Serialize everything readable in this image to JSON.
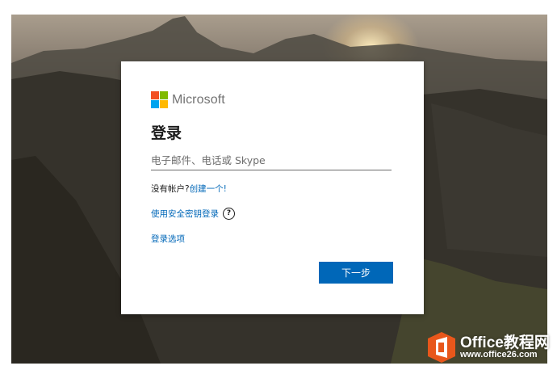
{
  "brand": {
    "name": "Microsoft",
    "logo_colors": [
      "#f25022",
      "#7fba00",
      "#00a4ef",
      "#ffb900"
    ]
  },
  "signin": {
    "title": "登录",
    "email_placeholder": "电子邮件、电话或 Skype",
    "email_value": "",
    "no_account_text": "没有帐户?",
    "create_link": "创建一个!",
    "security_key_link": "使用安全密钥登录",
    "help_icon": "?",
    "options_link": "登录选项",
    "next_button": "下一步"
  },
  "colors": {
    "accent": "#0067b8",
    "watermark_orange": "#e8571b"
  },
  "watermark": {
    "title": "Office教程网",
    "url": "www.office26.com",
    "icon": "office-logo-icon"
  }
}
